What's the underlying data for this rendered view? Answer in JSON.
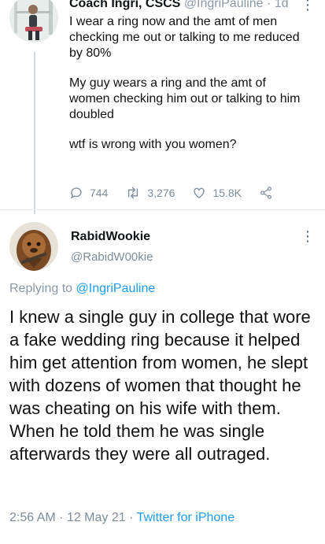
{
  "parent_tweet": {
    "display_name": "Coach Ingri, CSCS",
    "handle": "@IngriPauline",
    "separator": " · ",
    "time": "1d",
    "more": "⋮",
    "paragraphs": [
      "I wear a ring now and the amt of men checking me out or talking to me reduced by 80%",
      "My guy wears a ring and the amt of women checking him out or talking to him doubled",
      "wtf is wrong with you women?"
    ],
    "actions": {
      "replies": "744",
      "retweets": "3,276",
      "likes": "15.8K"
    }
  },
  "reply_tweet": {
    "display_name": "RabidWookie",
    "handle": "@RabidW00kie",
    "more": "⋮",
    "replying_prefix": "Replying to",
    "replying_to": "@IngriPauline",
    "text": "I knew a single guy in college that wore a fake wedding ring because it helped him get attention from women, he slept with dozens of women that thought he was cheating on his wife with them. When he told them he was single afterwards they were all outraged.",
    "time": "2:56 AM",
    "date": "12 May 21",
    "separator": "·",
    "client": "Twitter for iPhone"
  },
  "colors": {
    "link": "#1d9bf0",
    "muted": "#7f8c99",
    "divider": "#e6ecf0"
  }
}
